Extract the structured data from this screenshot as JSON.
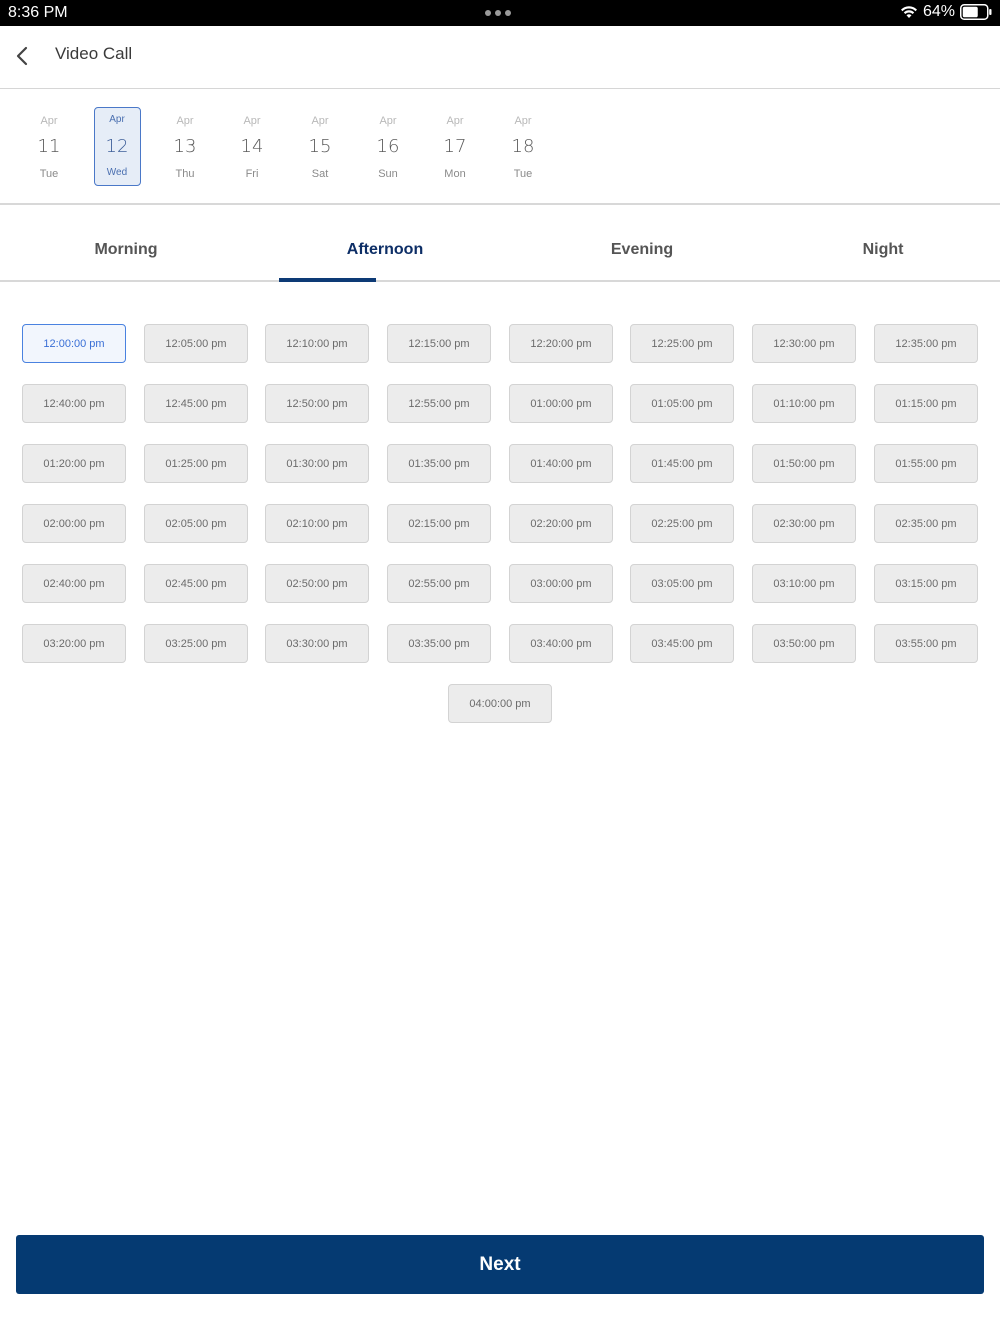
{
  "status_bar": {
    "time": "8:36 PM",
    "battery": "64%"
  },
  "header": {
    "title": "Video Call"
  },
  "dates": [
    {
      "month": "Apr",
      "day": "11",
      "weekday": "Tue",
      "selected": false
    },
    {
      "month": "Apr",
      "day": "12",
      "weekday": "Wed",
      "selected": true
    },
    {
      "month": "Apr",
      "day": "13",
      "weekday": "Thu",
      "selected": false
    },
    {
      "month": "Apr",
      "day": "14",
      "weekday": "Fri",
      "selected": false
    },
    {
      "month": "Apr",
      "day": "15",
      "weekday": "Sat",
      "selected": false
    },
    {
      "month": "Apr",
      "day": "16",
      "weekday": "Sun",
      "selected": false
    },
    {
      "month": "Apr",
      "day": "17",
      "weekday": "Mon",
      "selected": false
    },
    {
      "month": "Apr",
      "day": "18",
      "weekday": "Tue",
      "selected": false
    }
  ],
  "tabs": [
    {
      "label": "Morning",
      "active": false
    },
    {
      "label": "Afternoon",
      "active": true
    },
    {
      "label": "Evening",
      "active": false
    },
    {
      "label": "Night",
      "active": false
    }
  ],
  "time_slots": [
    "12:00:00 pm",
    "12:05:00 pm",
    "12:10:00 pm",
    "12:15:00 pm",
    "12:20:00 pm",
    "12:25:00 pm",
    "12:30:00 pm",
    "12:35:00 pm",
    "12:40:00 pm",
    "12:45:00 pm",
    "12:50:00 pm",
    "12:55:00 pm",
    "01:00:00 pm",
    "01:05:00 pm",
    "01:10:00 pm",
    "01:15:00 pm",
    "01:20:00 pm",
    "01:25:00 pm",
    "01:30:00 pm",
    "01:35:00 pm",
    "01:40:00 pm",
    "01:45:00 pm",
    "01:50:00 pm",
    "01:55:00 pm",
    "02:00:00 pm",
    "02:05:00 pm",
    "02:10:00 pm",
    "02:15:00 pm",
    "02:20:00 pm",
    "02:25:00 pm",
    "02:30:00 pm",
    "02:35:00 pm",
    "02:40:00 pm",
    "02:45:00 pm",
    "02:50:00 pm",
    "02:55:00 pm",
    "03:00:00 pm",
    "03:05:00 pm",
    "03:10:00 pm",
    "03:15:00 pm",
    "03:20:00 pm",
    "03:25:00 pm",
    "03:30:00 pm",
    "03:35:00 pm",
    "03:40:00 pm",
    "03:45:00 pm",
    "03:50:00 pm",
    "03:55:00 pm",
    "04:00:00 pm"
  ],
  "selected_slot": "12:00:00 pm",
  "next_label": "Next",
  "colors": {
    "primary": "#053a72",
    "selected_accent": "#4a82e0",
    "slot_bg": "#ececec"
  }
}
